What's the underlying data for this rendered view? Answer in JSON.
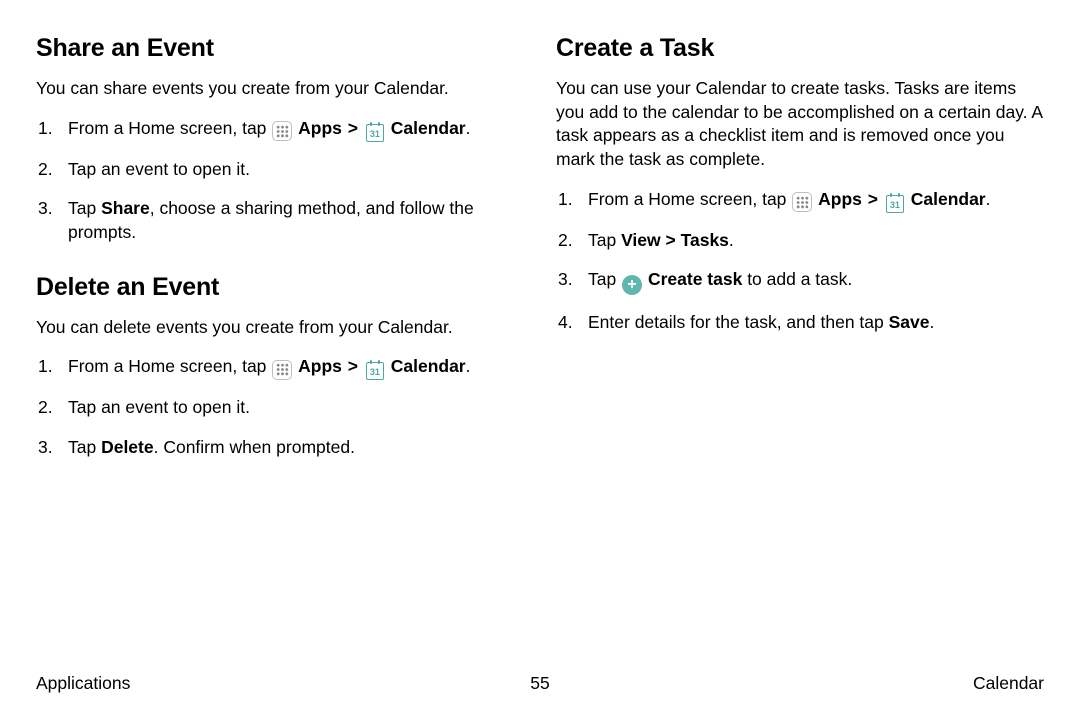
{
  "left": {
    "share": {
      "heading": "Share an Event",
      "intro": "You can share events you create from your Calendar.",
      "steps": {
        "s1_prefix": "From a Home screen, tap ",
        "apps_label": "Apps",
        "calendar_label": "Calendar",
        "s1_suffix": ".",
        "s2": "Tap an event to open it.",
        "s3_prefix": "Tap ",
        "s3_bold": "Share",
        "s3_suffix": ", choose a sharing method, and follow the prompts."
      }
    },
    "delete": {
      "heading": "Delete an Event",
      "intro": "You can delete events you create from your Calendar.",
      "steps": {
        "s1_prefix": "From a Home screen, tap ",
        "apps_label": "Apps",
        "calendar_label": "Calendar",
        "s1_suffix": ".",
        "s2": "Tap an event to open it.",
        "s3_prefix": "Tap ",
        "s3_bold": "Delete",
        "s3_suffix": ". Confirm when prompted."
      }
    }
  },
  "right": {
    "task": {
      "heading": "Create a Task",
      "intro": "You can use your Calendar to create tasks. Tasks are items you add to the calendar to be accomplished on a certain day. A task appears as a checklist item and is removed once you mark the task as complete.",
      "steps": {
        "s1_prefix": "From a Home screen, tap ",
        "apps_label": "Apps",
        "calendar_label": "Calendar",
        "s1_suffix": ".",
        "s2_prefix": "Tap ",
        "s2_bold": "View > Tasks",
        "s2_suffix": ".",
        "s3_prefix": "Tap ",
        "s3_bold": "Create task",
        "s3_suffix": " to add a task.",
        "s4_prefix": "Enter details for the task, and then tap ",
        "s4_bold": "Save",
        "s4_suffix": "."
      }
    }
  },
  "icons": {
    "calendar_day": "31"
  },
  "footer": {
    "left": "Applications",
    "center": "55",
    "right": "Calendar"
  }
}
